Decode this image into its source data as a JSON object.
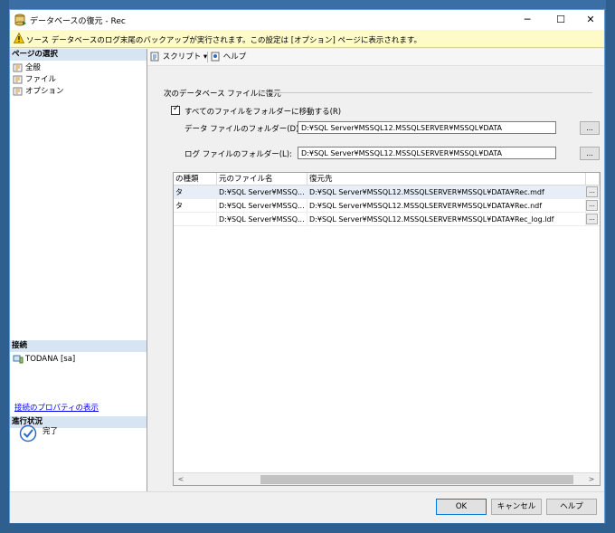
{
  "window": {
    "title": "データベースの復元 - Rec",
    "minimize": "─",
    "maximize": "☐",
    "close": "✕"
  },
  "info_bar": {
    "text": "ソース データベースのログ末尾のバックアップが実行されます。この設定は [オプション] ページに表示されます。"
  },
  "sidebar": {
    "page_select_header": "ページの選択",
    "pages": [
      {
        "label": "全般"
      },
      {
        "label": "ファイル"
      },
      {
        "label": "オプション"
      }
    ],
    "connection_header": "接続",
    "connection": "TODANA [sa]",
    "connection_props_link": "接続のプロパティの表示",
    "progress_header": "進行状況",
    "progress_status": "完了"
  },
  "toolbar": {
    "script_label": "スクリプト",
    "script_dropdown": "▾",
    "help_label": "ヘルプ"
  },
  "files_page": {
    "section_label": "次のデータベース ファイルに復元",
    "relocate_checkbox_label": "すべてのファイルをフォルダーに移動する(R)",
    "relocate_checked": true,
    "data_folder_label": "データ ファイルのフォルダー(D):",
    "data_folder_value": "D:¥SQL Server¥MSSQL12.MSSQLSERVER¥MSSQL¥DATA",
    "log_folder_label": "ログ ファイルのフォルダー(L):",
    "log_folder_value": "D:¥SQL Server¥MSSQL12.MSSQLSERVER¥MSSQL¥DATA",
    "browse_label": "...",
    "grid": {
      "columns": [
        "の種類",
        "元のファイル名",
        "復元先"
      ],
      "rows": [
        {
          "type": "タ",
          "original": "D:¥SQL Server¥MSSQ...",
          "restore_as": "D:¥SQL Server¥MSSQL12.MSSQLSERVER¥MSSQL¥DATA¥Rec.mdf"
        },
        {
          "type": "タ",
          "original": "D:¥SQL Server¥MSSQ...",
          "restore_as": "D:¥SQL Server¥MSSQL12.MSSQLSERVER¥MSSQL¥DATA¥Rec.ndf"
        },
        {
          "type": "",
          "original": "D:¥SQL Server¥MSSQ...",
          "restore_as": "D:¥SQL Server¥MSSQL12.MSSQLSERVER¥MSSQL¥DATA¥Rec_log.ldf"
        }
      ],
      "row_button": "...",
      "scroll_left": "<",
      "scroll_right": ">"
    }
  },
  "buttons": {
    "ok": "OK",
    "cancel": "キャンセル",
    "help": "ヘルプ"
  }
}
